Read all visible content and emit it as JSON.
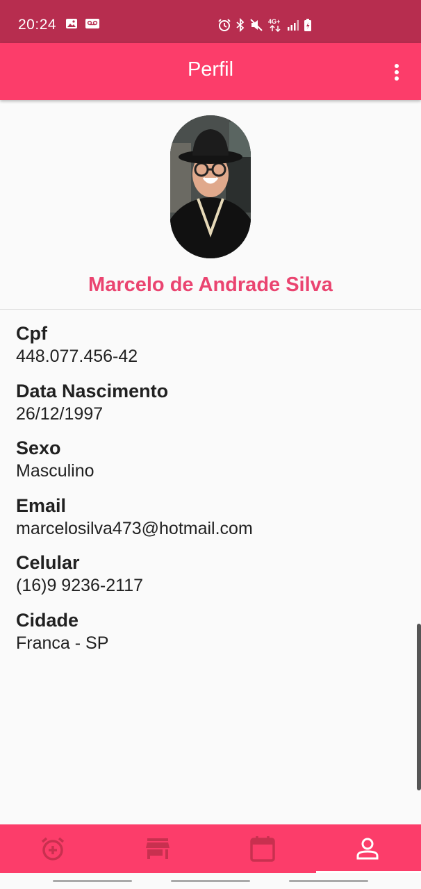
{
  "status_bar": {
    "time": "20:24",
    "left_icons": [
      "image-icon",
      "voicemail-icon"
    ],
    "right_icons": [
      "alarm-icon",
      "bluetooth-icon",
      "mute-icon",
      "network-4g-icon",
      "signal-icon",
      "battery-icon"
    ],
    "network_label": "4G+"
  },
  "app_bar": {
    "title": "Perfil",
    "menu_icon": "more-vert-icon"
  },
  "profile": {
    "name": "Marcelo de Andrade Silva"
  },
  "fields": [
    {
      "label": "Cpf",
      "value": "448.077.456-42"
    },
    {
      "label": "Data Nascimento",
      "value": "26/12/1997"
    },
    {
      "label": "Sexo",
      "value": "Masculino"
    },
    {
      "label": "Email",
      "value": "marcelosilva473@hotmail.com"
    },
    {
      "label": "Celular",
      "value": "(16)9 9236-2117"
    },
    {
      "label": "Cidade",
      "value": "Franca - SP"
    }
  ],
  "bottom_nav": {
    "items": [
      {
        "icon": "alarm-add-icon",
        "active": false
      },
      {
        "icon": "store-icon",
        "active": false
      },
      {
        "icon": "calendar-icon",
        "active": false
      },
      {
        "icon": "person-icon",
        "active": true
      }
    ]
  },
  "colors": {
    "status_bar": "#b72d4f",
    "primary": "#fc3d6a",
    "name_accent": "#ea4470",
    "inactive_icon": "#c8304f"
  }
}
